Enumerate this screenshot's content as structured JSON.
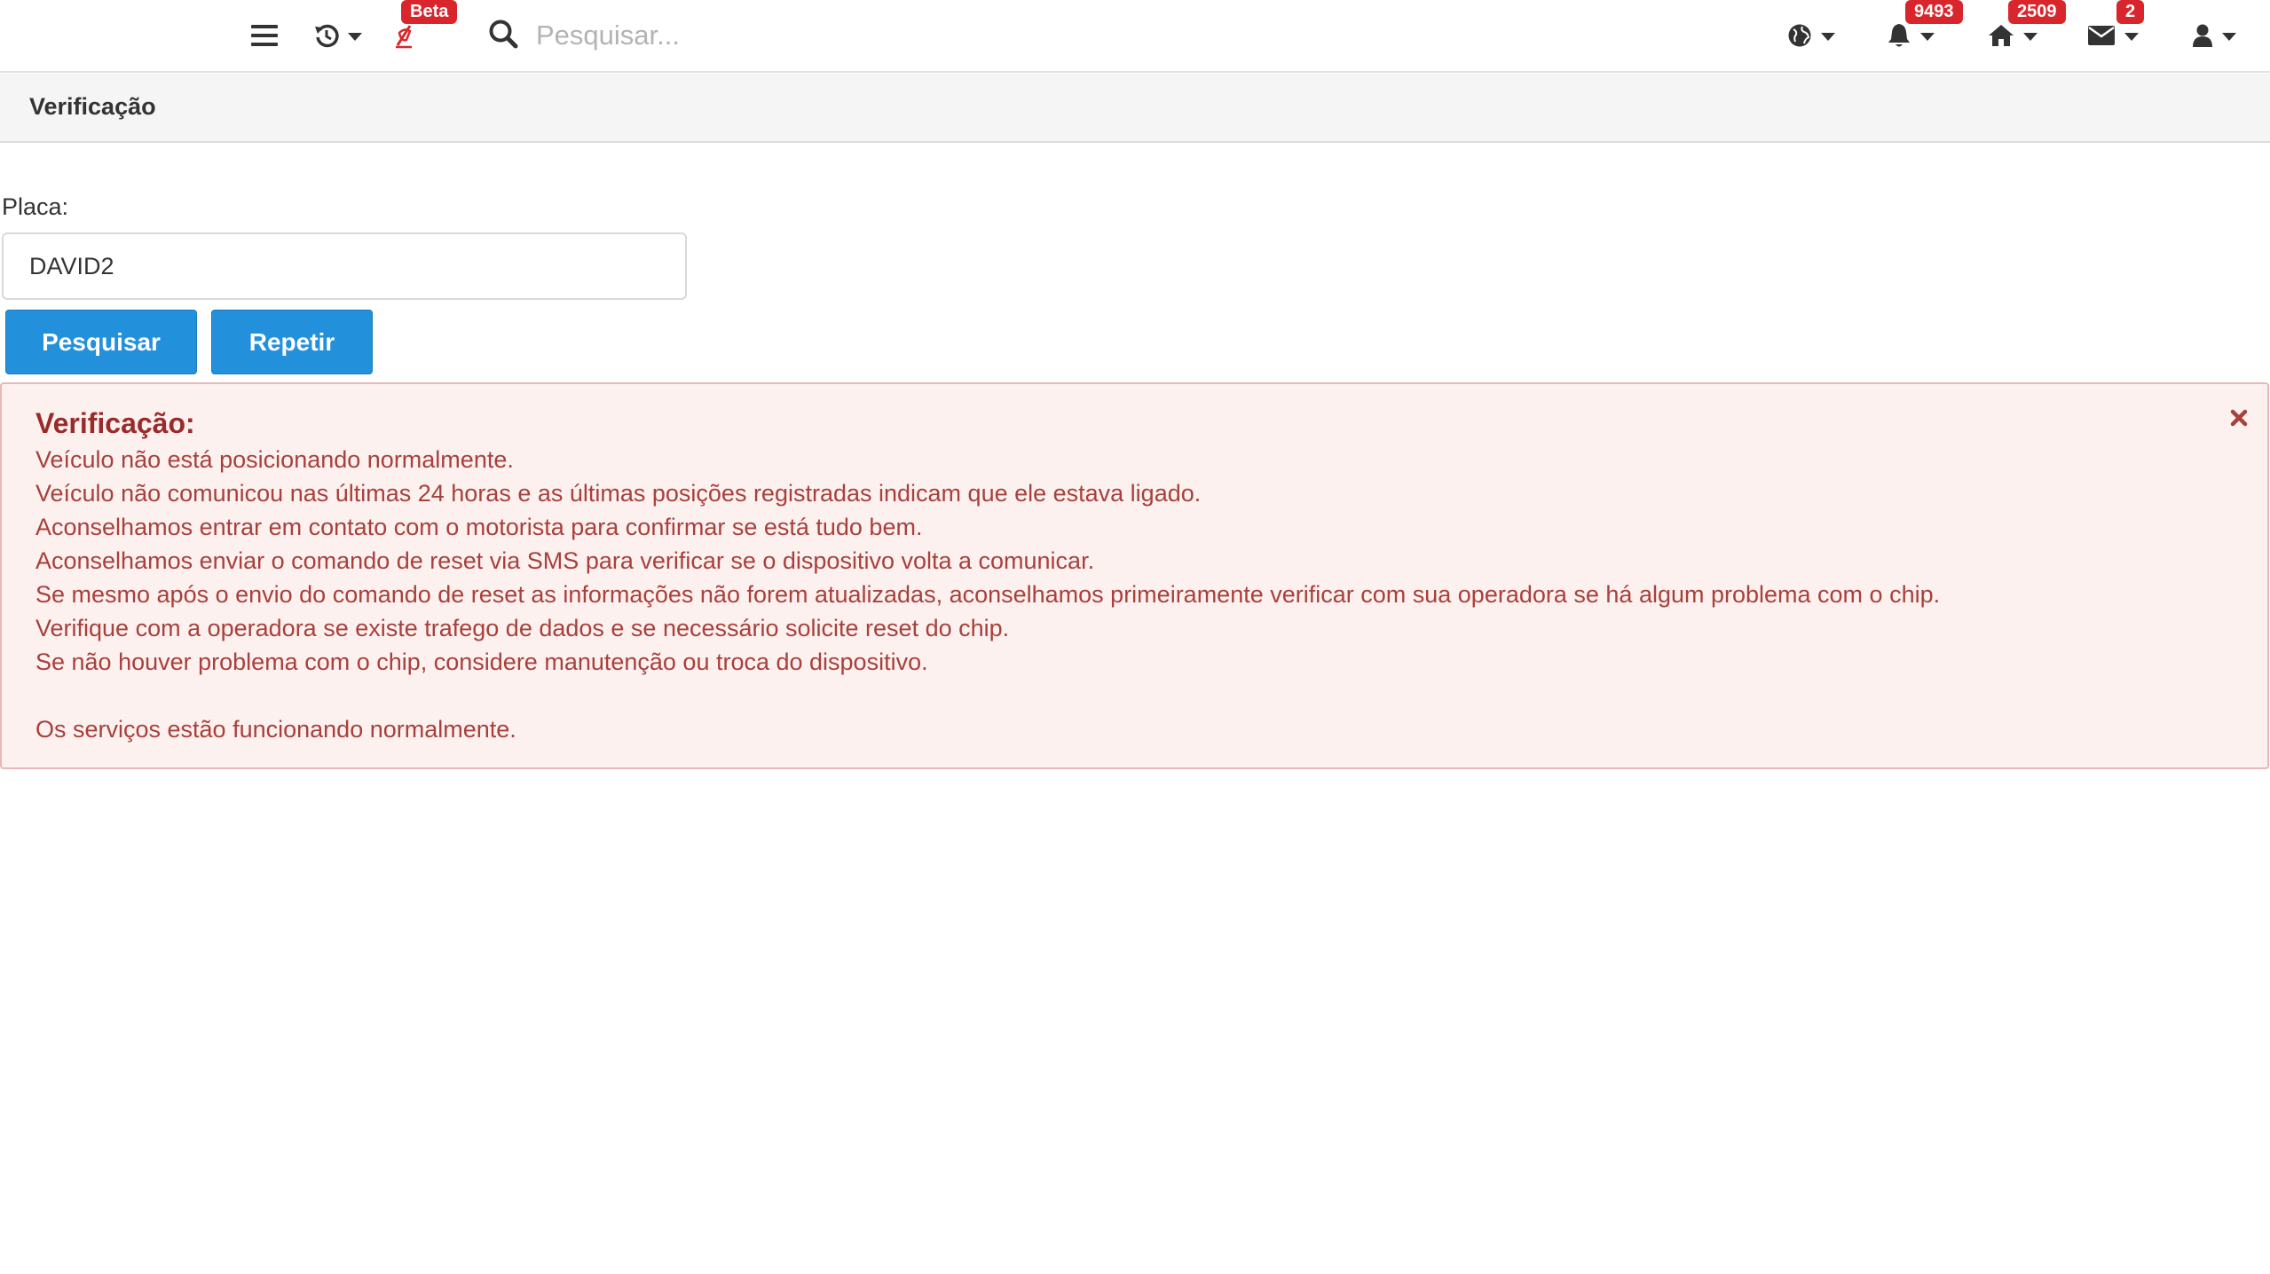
{
  "navbar": {
    "beta_badge": "Beta",
    "search_placeholder": "Pesquisar...",
    "notifications_count": "9493",
    "home_count": "2509",
    "messages_count": "2"
  },
  "header": {
    "title": "Verificação"
  },
  "form": {
    "label": "Placa:",
    "plate_value": "DAVID2",
    "search_button": "Pesquisar",
    "repeat_button": "Repetir"
  },
  "alert": {
    "title": "Verificação:",
    "lines": [
      "Veículo não está posicionando normalmente.",
      "Veículo não comunicou nas últimas 24 horas e as últimas posições registradas indicam que ele estava ligado.",
      "Aconselhamos entrar em contato com o motorista para confirmar se está tudo bem.",
      "Aconselhamos enviar o comando de reset via SMS para verificar se o dispositivo volta a comunicar.",
      "Se mesmo após o envio do comando de reset as informações não forem atualizadas, aconselhamos primeiramente verificar com sua operadora se há algum problema com o chip.",
      "Verifique com a operadora se existe trafego de dados e se necessário solicite reset do chip.",
      "Se não houver problema com o chip, considere manutenção ou troca do dispositivo."
    ],
    "footer": "Os serviços estão funcionando normalmente.",
    "colors": {
      "background": "#fdf1f0",
      "border": "#e9b7b5",
      "text": "#a8403b"
    }
  },
  "colors": {
    "primary_button": "#2390dc",
    "badge": "#d9262d"
  },
  "icons": [
    "menu-icon",
    "history-icon",
    "beta-feature-icon",
    "search-icon",
    "globe-icon",
    "bell-icon",
    "home-icon",
    "envelope-icon",
    "user-icon",
    "close-icon"
  ]
}
